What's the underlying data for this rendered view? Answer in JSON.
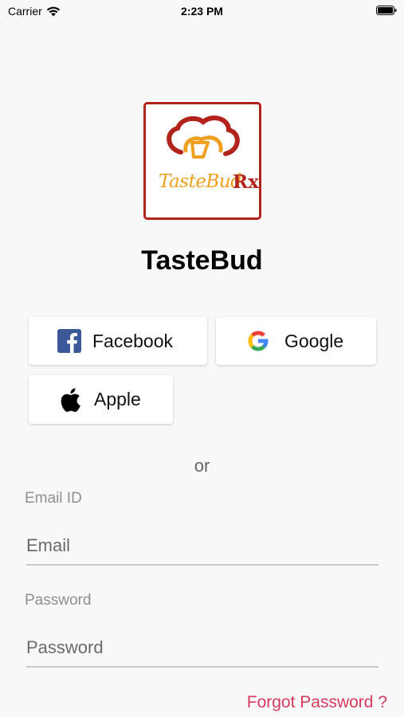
{
  "status_bar": {
    "carrier": "Carrier",
    "time": "2:23 PM"
  },
  "logo": {
    "wordmark": "TasteBud",
    "rx": "Rx",
    "border_color": "#b3231c",
    "accent_color": "#f0a020"
  },
  "app_title": "TasteBud",
  "social": {
    "facebook_label": "Facebook",
    "google_label": "Google",
    "apple_label": "Apple"
  },
  "divider_text": "or",
  "email": {
    "label": "Email ID",
    "placeholder": "Email",
    "value": ""
  },
  "password": {
    "label": "Password",
    "placeholder": "Password",
    "value": ""
  },
  "forgot_password": "Forgot Password ?",
  "colors": {
    "link": "#d63a5f",
    "facebook": "#3b5998"
  },
  "icons": [
    "wifi-icon",
    "battery-icon",
    "facebook-icon",
    "google-icon",
    "apple-icon",
    "chef-hat-icon"
  ]
}
